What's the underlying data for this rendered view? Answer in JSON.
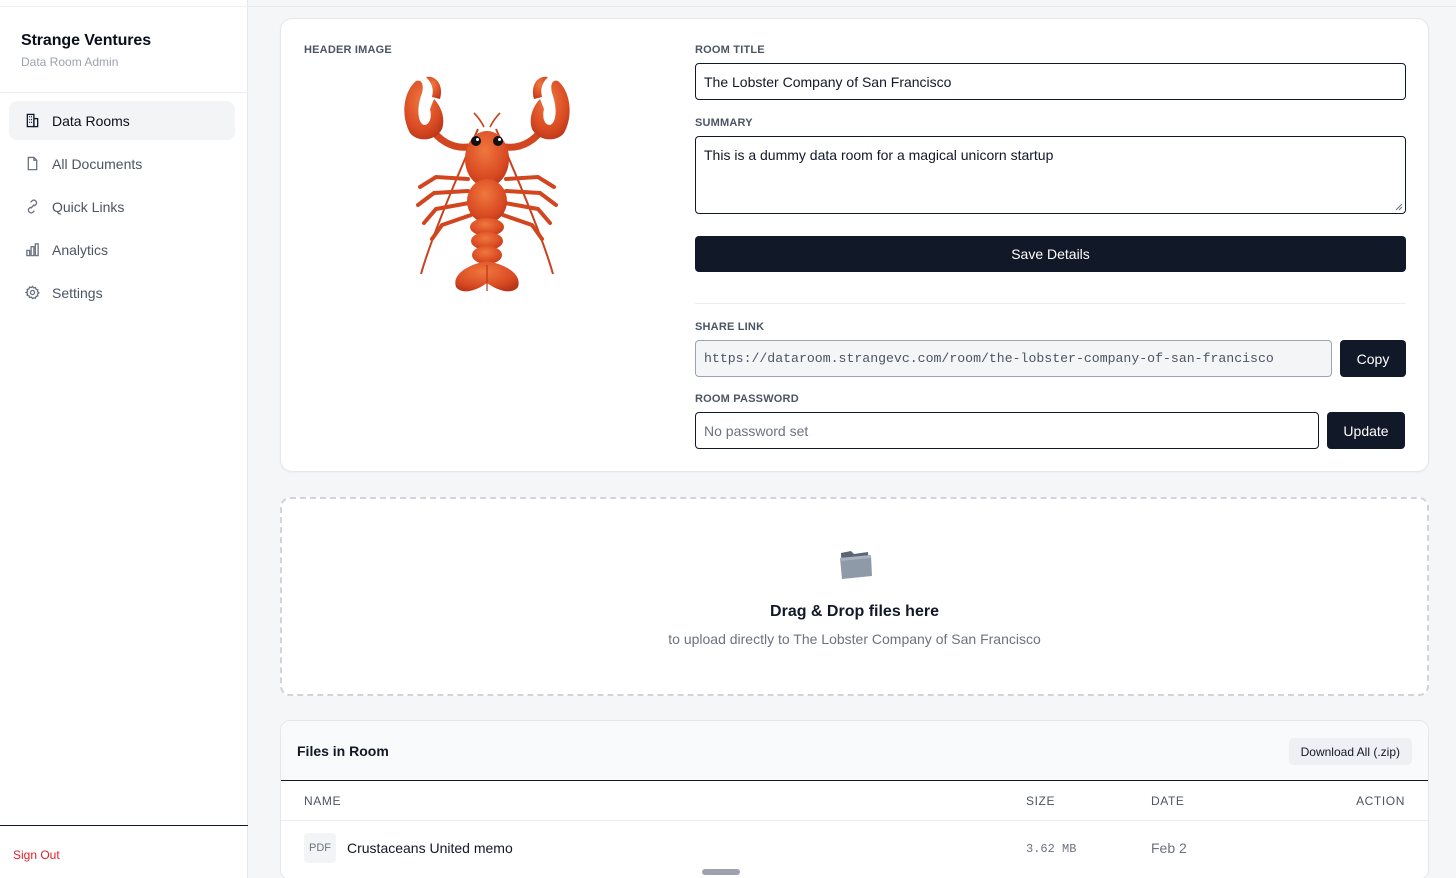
{
  "sidebar": {
    "brand_title": "Strange Ventures",
    "brand_subtitle": "Data Room Admin",
    "items": [
      {
        "label": "Data Rooms",
        "icon": "building-icon",
        "active": true
      },
      {
        "label": "All Documents",
        "icon": "document-icon",
        "active": false
      },
      {
        "label": "Quick Links",
        "icon": "link-icon",
        "active": false
      },
      {
        "label": "Analytics",
        "icon": "bar-chart-icon",
        "active": false
      },
      {
        "label": "Settings",
        "icon": "gear-icon",
        "active": false
      }
    ],
    "sign_out": "Sign Out"
  },
  "details": {
    "header_image_label": "HEADER IMAGE",
    "header_image_icon": "lobster-image",
    "room_title_label": "ROOM TITLE",
    "room_title_value": "The Lobster Company of San Francisco",
    "summary_label": "SUMMARY",
    "summary_value": "This is a dummy data room for a magical unicorn startup",
    "save_label": "Save Details",
    "share_link_label": "SHARE LINK",
    "share_link_value": "https://dataroom.strangevc.com/room/the-lobster-company-of-san-francisco",
    "copy_label": "Copy",
    "password_label": "ROOM PASSWORD",
    "password_placeholder": "No password set",
    "update_label": "Update"
  },
  "dropzone": {
    "icon": "folder-icon",
    "title": "Drag & Drop files here",
    "subtitle": "to upload directly to The Lobster Company of San Francisco"
  },
  "files": {
    "title": "Files in Room",
    "download_all_label": "Download All (.zip)",
    "columns": {
      "name": "NAME",
      "size": "SIZE",
      "date": "DATE",
      "action": "ACTION"
    },
    "rows": [
      {
        "type": "PDF",
        "name": "Crustaceans United memo",
        "size": "3.62 MB",
        "date": "Feb 2"
      }
    ]
  },
  "colors": {
    "accent_dark": "#111827",
    "sign_out_red": "#e11d2a",
    "lobster_orange": "#e5582a"
  }
}
